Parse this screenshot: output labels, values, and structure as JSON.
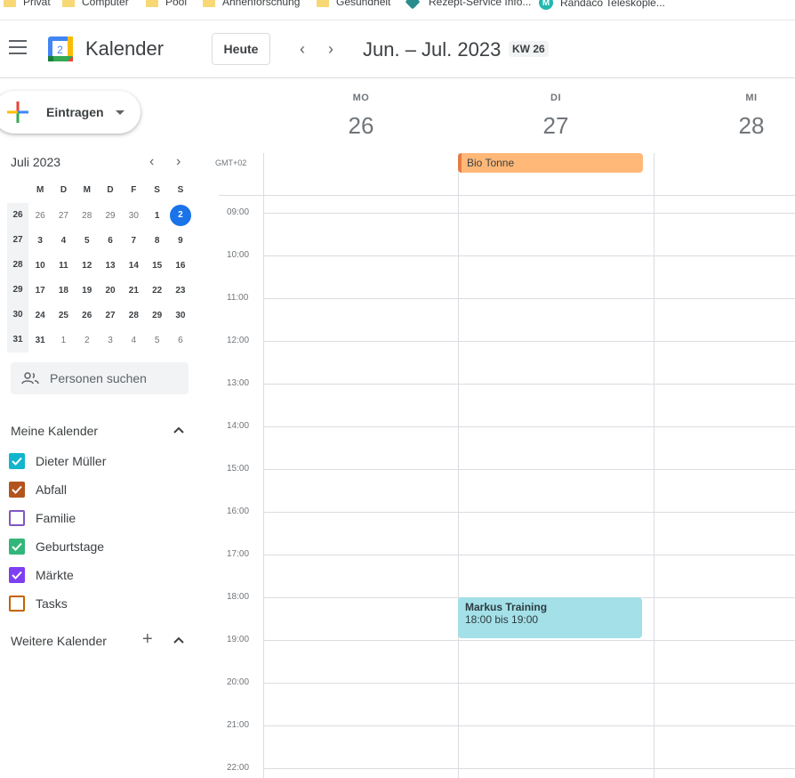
{
  "bookmarks": [
    {
      "label": "Privat",
      "icon": "folder-icon"
    },
    {
      "label": "Computer",
      "icon": "folder-icon"
    },
    {
      "label": "Pool",
      "icon": "folder-icon"
    },
    {
      "label": "Ahnenforschung",
      "icon": "folder-icon"
    },
    {
      "label": "Gesundheit",
      "icon": "folder-icon"
    },
    {
      "label": "Rezept-Service Info...",
      "icon": "recipe-icon"
    },
    {
      "label": "Randaco Teleskople...",
      "icon": "m-logo-icon"
    }
  ],
  "header": {
    "logo_day": "2",
    "title": "Kalender",
    "today_label": "Heute",
    "range": "Jun. – Jul. 2023",
    "week": "KW 26"
  },
  "create": {
    "label": "Eintragen"
  },
  "mini_calendar": {
    "title": "Juli 2023",
    "weekday_heads": [
      "M",
      "D",
      "M",
      "D",
      "F",
      "S",
      "S"
    ],
    "rows": [
      {
        "week": "26",
        "days": [
          "26",
          "27",
          "28",
          "29",
          "30",
          "1",
          "2"
        ]
      },
      {
        "week": "27",
        "days": [
          "3",
          "4",
          "5",
          "6",
          "7",
          "8",
          "9"
        ]
      },
      {
        "week": "28",
        "days": [
          "10",
          "11",
          "12",
          "13",
          "14",
          "15",
          "16"
        ]
      },
      {
        "week": "29",
        "days": [
          "17",
          "18",
          "19",
          "20",
          "21",
          "22",
          "23"
        ]
      },
      {
        "week": "30",
        "days": [
          "24",
          "25",
          "26",
          "27",
          "28",
          "29",
          "30"
        ]
      },
      {
        "week": "31",
        "days": [
          "31",
          "1",
          "2",
          "3",
          "4",
          "5",
          "6"
        ]
      }
    ]
  },
  "people_search": {
    "placeholder": "Personen suchen"
  },
  "my_calendars": {
    "title": "Meine Kalender",
    "items": [
      {
        "label": "Dieter Müller",
        "color": "#12b5cb",
        "checked": true
      },
      {
        "label": "Abfall",
        "color": "#b3541e",
        "checked": true
      },
      {
        "label": "Familie",
        "color": "#7e57c2",
        "checked": false
      },
      {
        "label": "Geburtstage",
        "color": "#33b679",
        "checked": true
      },
      {
        "label": "Märkte",
        "color": "#7e3ff2",
        "checked": true
      },
      {
        "label": "Tasks",
        "color": "#c26401",
        "checked": false
      }
    ]
  },
  "other_calendars": {
    "title": "Weitere Kalender"
  },
  "grid": {
    "timezone": "GMT+02",
    "days": [
      {
        "dow": "MO",
        "num": "26"
      },
      {
        "dow": "DI",
        "num": "27"
      },
      {
        "dow": "MI",
        "num": "28"
      }
    ],
    "hours": [
      "09:00",
      "10:00",
      "11:00",
      "12:00",
      "13:00",
      "14:00",
      "15:00",
      "16:00",
      "17:00",
      "18:00",
      "19:00",
      "20:00",
      "21:00",
      "22:00"
    ]
  },
  "events": {
    "allday": {
      "title": "Bio Tonne",
      "color": "#ffb878"
    },
    "timed": {
      "title": "Markus Training",
      "time": "18:00 bis 19:00",
      "color": "#a4e0e8"
    }
  }
}
